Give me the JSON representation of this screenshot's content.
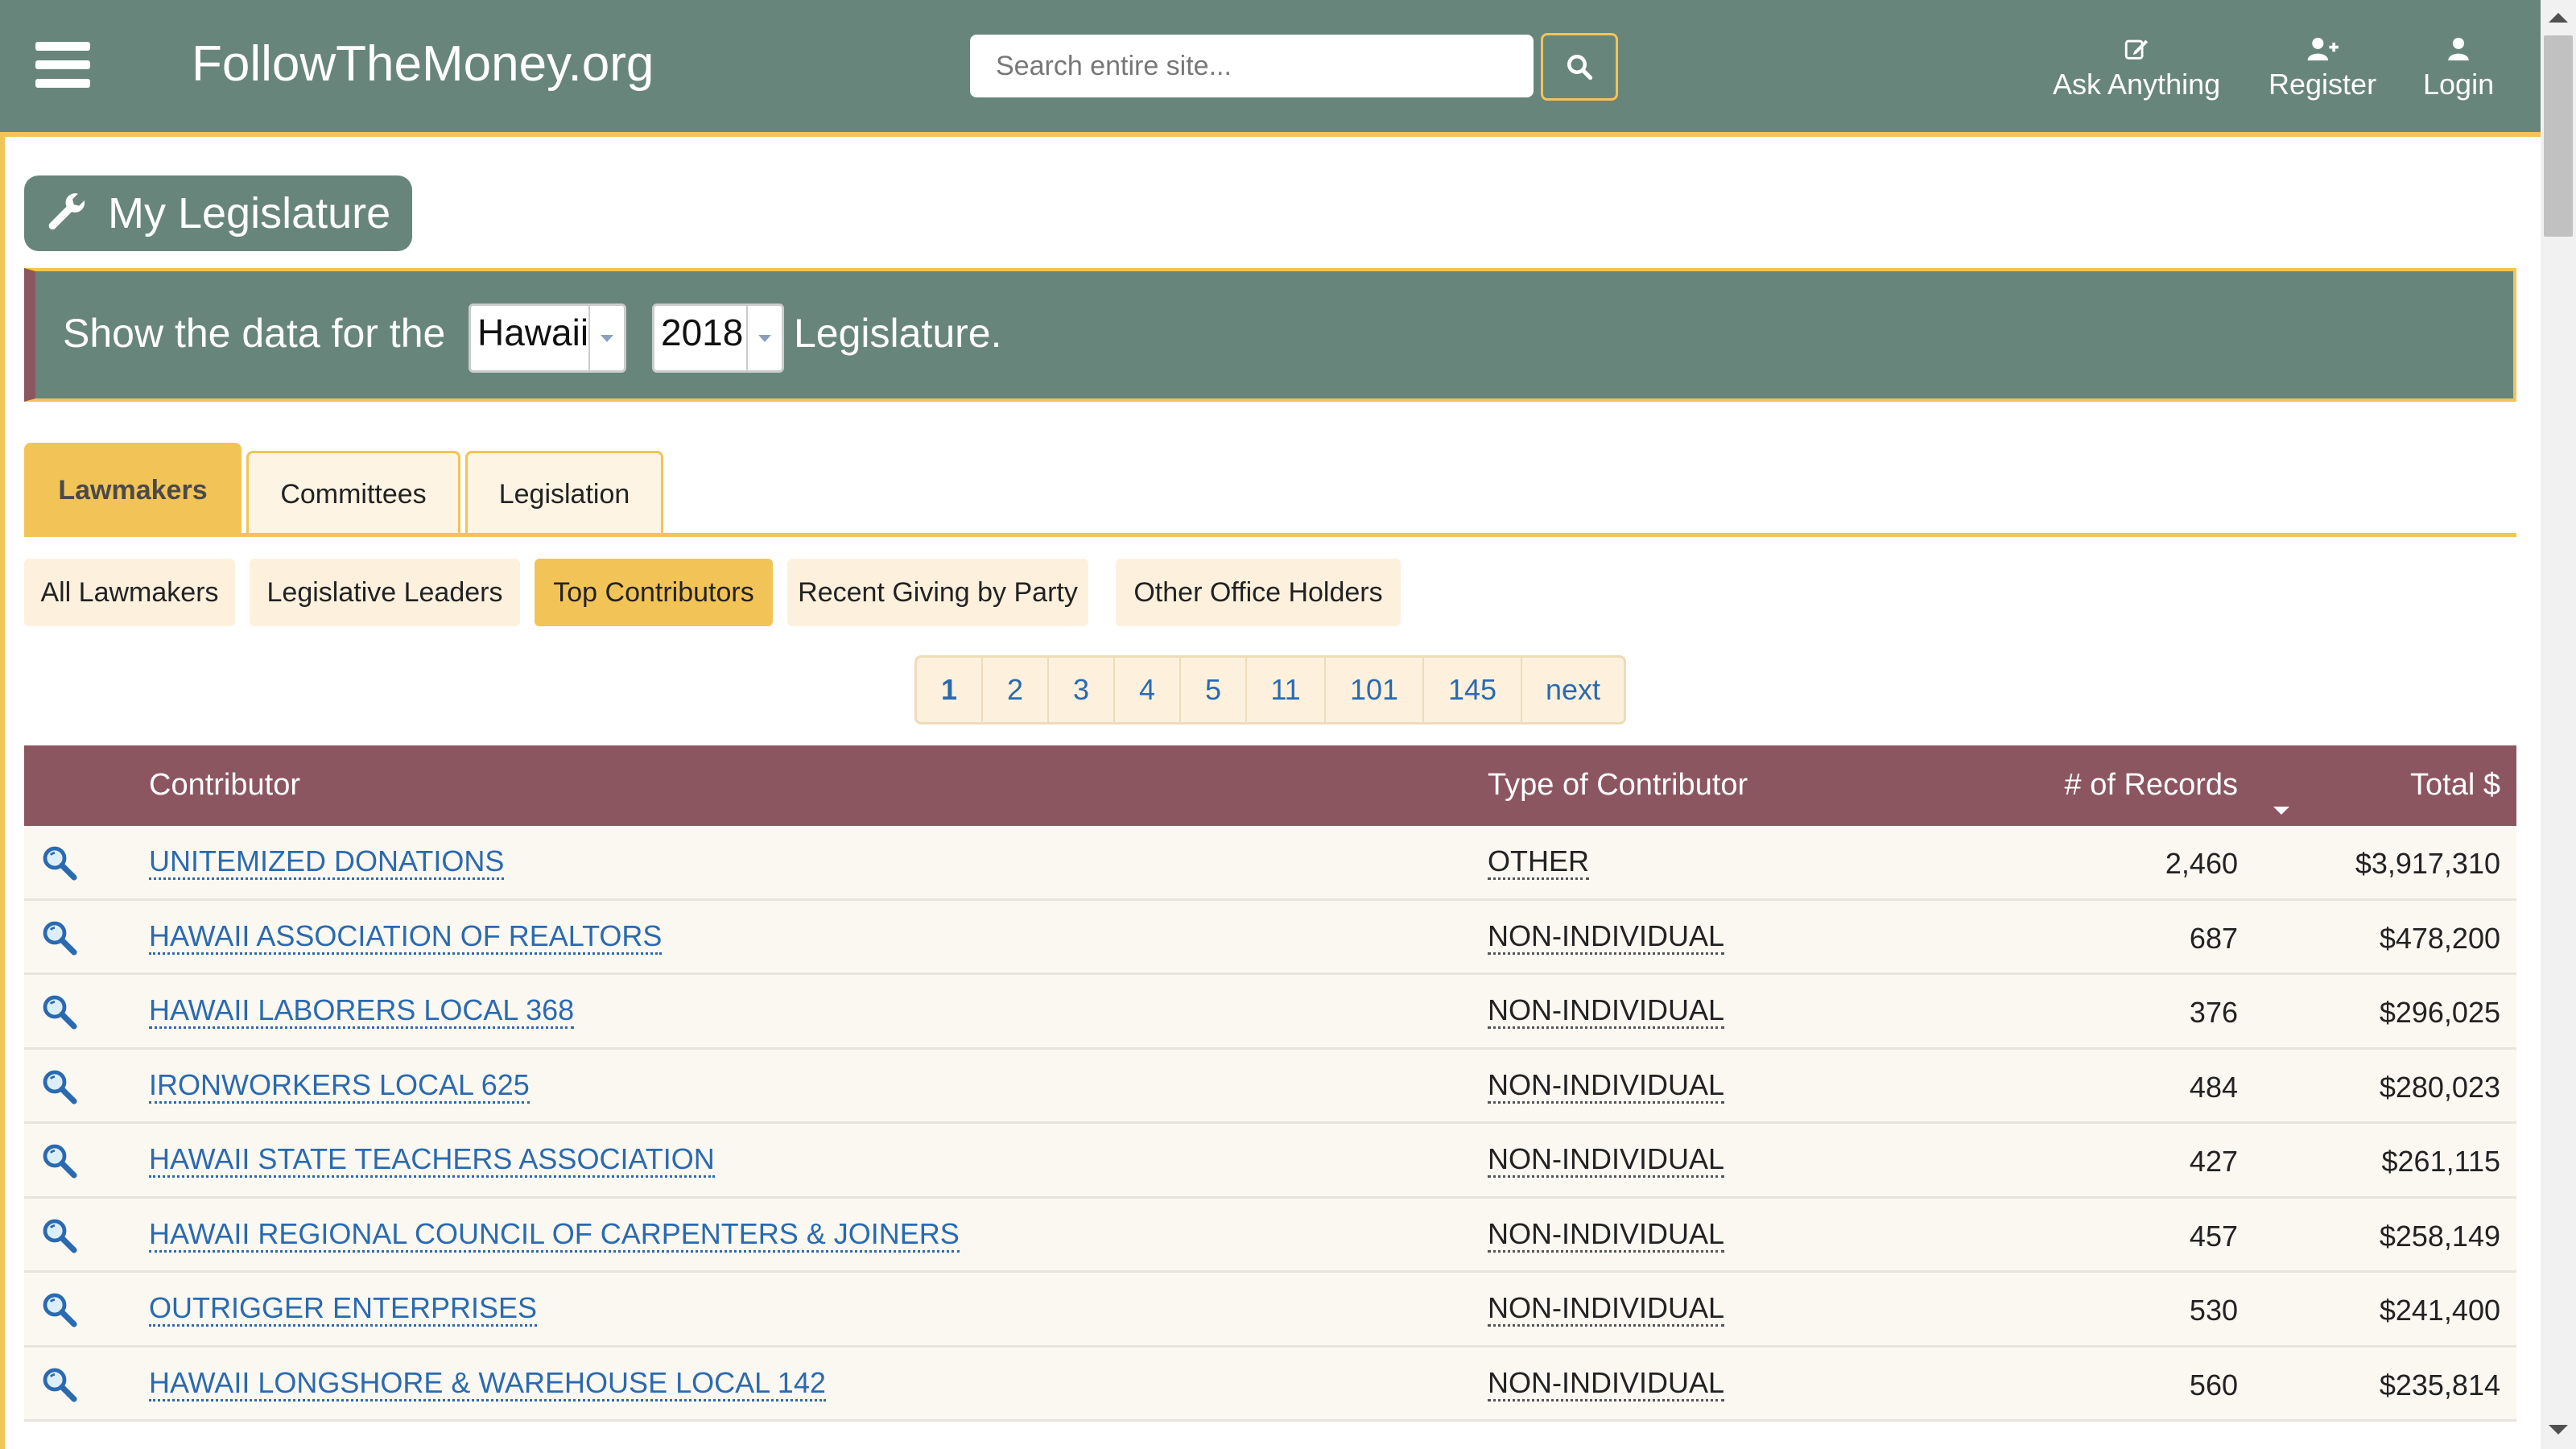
{
  "header": {
    "site_title": "FollowTheMoney.org",
    "search_placeholder": "Search entire site...",
    "nav": [
      {
        "label": "Ask Anything",
        "icon": "edit-icon"
      },
      {
        "label": "Register",
        "icon": "user-plus-icon"
      },
      {
        "label": "Login",
        "icon": "user-icon"
      }
    ]
  },
  "page": {
    "title": "My Legislature",
    "selector": {
      "prefix": "Show the data for the",
      "state": "Hawaii",
      "year": "2018",
      "suffix": "Legislature."
    }
  },
  "tabs": [
    {
      "label": "Lawmakers",
      "active": true
    },
    {
      "label": "Committees",
      "active": false
    },
    {
      "label": "Legislation",
      "active": false
    }
  ],
  "subtabs": [
    {
      "label": "All Lawmakers",
      "active": false
    },
    {
      "label": "Legislative Leaders",
      "active": false
    },
    {
      "label": "Top Contributors",
      "active": true
    },
    {
      "label": "Recent Giving by Party",
      "active": false
    },
    {
      "label": "Other Office Holders",
      "active": false
    }
  ],
  "pagination": [
    "1",
    "2",
    "3",
    "4",
    "5",
    "11",
    "101",
    "145",
    "next"
  ],
  "table": {
    "columns": {
      "contributor": "Contributor",
      "type": "Type of Contributor",
      "records": "# of Records",
      "total": "Total $"
    },
    "rows": [
      {
        "contributor": "UNITEMIZED DONATIONS",
        "type": "OTHER",
        "records": "2,460",
        "total": "$3,917,310"
      },
      {
        "contributor": "HAWAII ASSOCIATION OF REALTORS",
        "type": "NON-INDIVIDUAL",
        "records": "687",
        "total": "$478,200"
      },
      {
        "contributor": "HAWAII LABORERS LOCAL 368",
        "type": "NON-INDIVIDUAL",
        "records": "376",
        "total": "$296,025"
      },
      {
        "contributor": "IRONWORKERS LOCAL 625",
        "type": "NON-INDIVIDUAL",
        "records": "484",
        "total": "$280,023"
      },
      {
        "contributor": "HAWAII STATE TEACHERS ASSOCIATION",
        "type": "NON-INDIVIDUAL",
        "records": "427",
        "total": "$261,115"
      },
      {
        "contributor": "HAWAII REGIONAL COUNCIL OF CARPENTERS & JOINERS",
        "type": "NON-INDIVIDUAL",
        "records": "457",
        "total": "$258,149"
      },
      {
        "contributor": "OUTRIGGER ENTERPRISES",
        "type": "NON-INDIVIDUAL",
        "records": "530",
        "total": "$241,400"
      },
      {
        "contributor": "HAWAII LONGSHORE & WAREHOUSE LOCAL 142",
        "type": "NON-INDIVIDUAL",
        "records": "560",
        "total": "$235,814"
      }
    ]
  },
  "colors": {
    "header_bg": "#68857c",
    "accent_gold": "#f2c457",
    "table_header_bg": "#8c5661",
    "link_blue": "#2a6ab0"
  }
}
